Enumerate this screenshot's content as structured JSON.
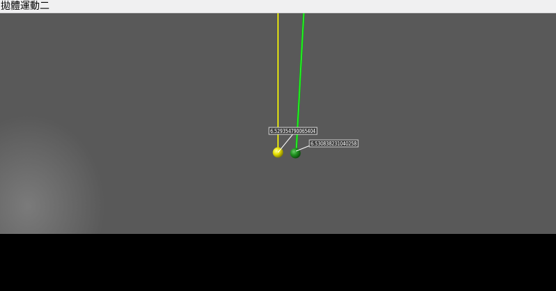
{
  "window": {
    "title": "拋體運動二"
  },
  "viewport": {
    "background": "#595959",
    "balls": [
      {
        "name": "yellow-ball",
        "color": "#e6e000",
        "trail_color": "#ffff00",
        "label": "6.529354790065404"
      },
      {
        "name": "green-ball",
        "color": "#1f8f1f",
        "trail_color": "#00d000",
        "label": "6.530838231040258"
      }
    ]
  }
}
